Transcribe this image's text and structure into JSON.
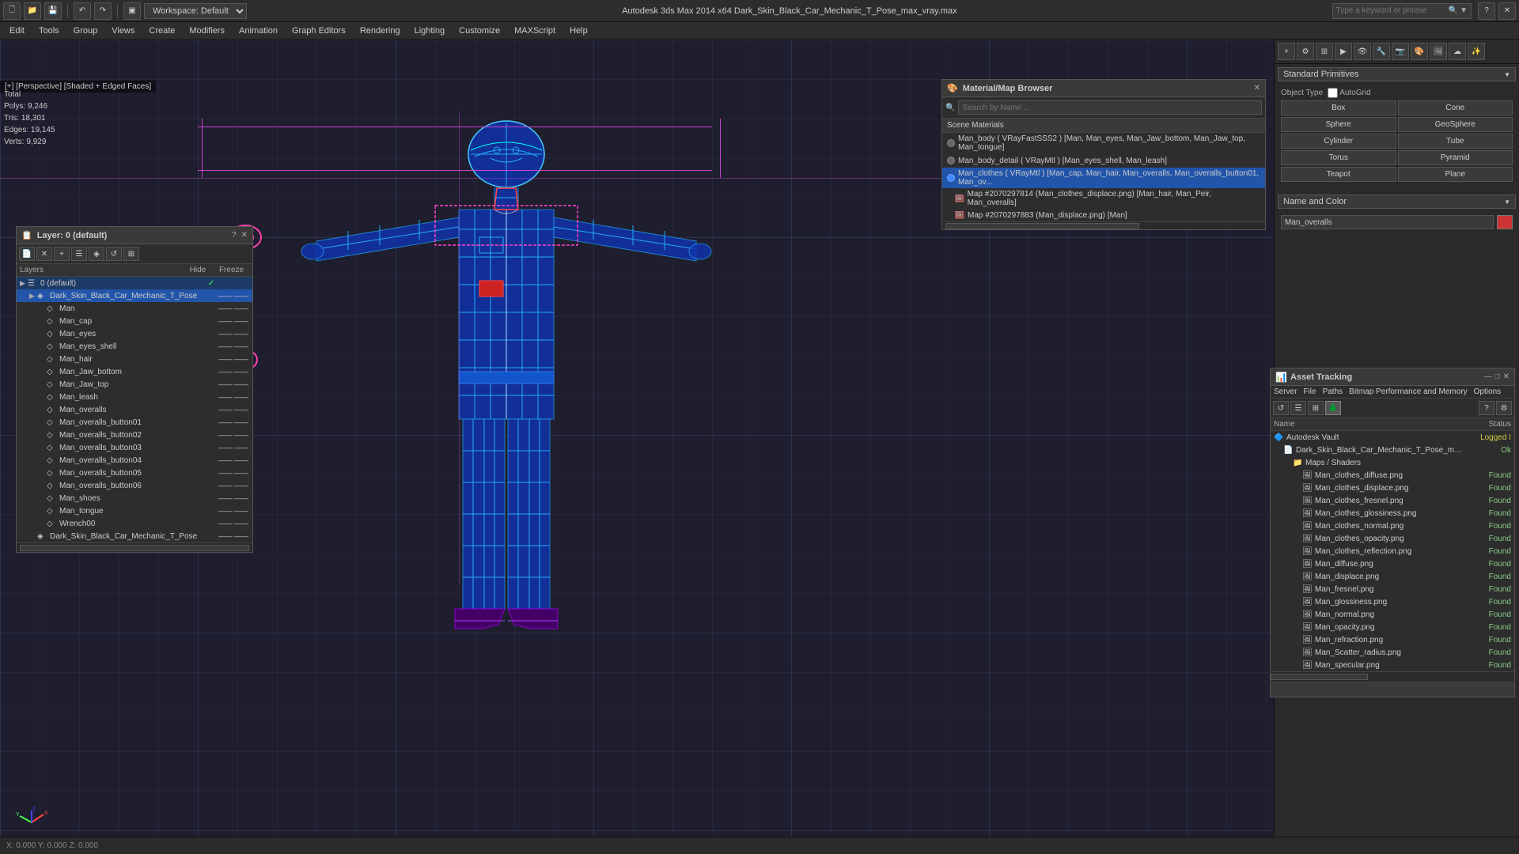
{
  "app": {
    "title": "Autodesk 3ds Max 2014 x64    Dark_Skin_Black_Car_Mechanic_T_Pose_max_vray.max",
    "workspace": "Workspace: Default"
  },
  "search": {
    "placeholder": "Type a keyword or phrase"
  },
  "menubar": {
    "items": [
      "Edit",
      "Tools",
      "Group",
      "Views",
      "Create",
      "Modifiers",
      "Animation",
      "Graph Editors",
      "Rendering",
      "Lighting",
      "Customize",
      "MAXScript",
      "Help"
    ]
  },
  "viewport": {
    "label": "[+] [Perspective] [Shaded + Edged Faces]"
  },
  "stats": {
    "polys_label": "Polys:",
    "polys_val": "9,246",
    "tris_label": "Tris:",
    "tris_val": "18,301",
    "edges_label": "Edges:",
    "edges_val": "19,145",
    "verts_label": "Verts:",
    "verts_val": "9,929",
    "total_label": "Total"
  },
  "layers_panel": {
    "title": "Layer: 0 (default)",
    "headers": {
      "name": "Layers",
      "hide": "Hide",
      "freeze": "Freeze"
    },
    "items": [
      {
        "indent": 0,
        "expand": true,
        "icon": "☰",
        "name": "0 (default)",
        "checked": true,
        "hide": "",
        "freeze": ""
      },
      {
        "indent": 1,
        "expand": true,
        "icon": "◈",
        "name": "Dark_Skin_Black_Car_Mechanic_T_Pose",
        "selected": true,
        "hide": "——",
        "freeze": "——"
      },
      {
        "indent": 2,
        "expand": false,
        "icon": "◇",
        "name": "Man",
        "hide": "——",
        "freeze": "——"
      },
      {
        "indent": 2,
        "expand": false,
        "icon": "◇",
        "name": "Man_cap",
        "hide": "——",
        "freeze": "——"
      },
      {
        "indent": 2,
        "expand": false,
        "icon": "◇",
        "name": "Man_eyes",
        "hide": "——",
        "freeze": "——"
      },
      {
        "indent": 2,
        "expand": false,
        "icon": "◇",
        "name": "Man_eyes_shell",
        "hide": "——",
        "freeze": "——"
      },
      {
        "indent": 2,
        "expand": false,
        "icon": "◇",
        "name": "Man_hair",
        "hide": "——",
        "freeze": "——"
      },
      {
        "indent": 2,
        "expand": false,
        "icon": "◇",
        "name": "Man_Jaw_bottom",
        "hide": "——",
        "freeze": "——"
      },
      {
        "indent": 2,
        "expand": false,
        "icon": "◇",
        "name": "Man_Jaw_top",
        "hide": "——",
        "freeze": "——"
      },
      {
        "indent": 2,
        "expand": false,
        "icon": "◇",
        "name": "Man_leash",
        "hide": "——",
        "freeze": "——"
      },
      {
        "indent": 2,
        "expand": false,
        "icon": "◇",
        "name": "Man_overalls",
        "hide": "——",
        "freeze": "——"
      },
      {
        "indent": 2,
        "expand": false,
        "icon": "◇",
        "name": "Man_overalls_button01",
        "hide": "——",
        "freeze": "——"
      },
      {
        "indent": 2,
        "expand": false,
        "icon": "◇",
        "name": "Man_overalls_button02",
        "hide": "——",
        "freeze": "——"
      },
      {
        "indent": 2,
        "expand": false,
        "icon": "◇",
        "name": "Man_overalls_button03",
        "hide": "——",
        "freeze": "——"
      },
      {
        "indent": 2,
        "expand": false,
        "icon": "◇",
        "name": "Man_overalls_button04",
        "hide": "——",
        "freeze": "——"
      },
      {
        "indent": 2,
        "expand": false,
        "icon": "◇",
        "name": "Man_overalls_button05",
        "hide": "——",
        "freeze": "——"
      },
      {
        "indent": 2,
        "expand": false,
        "icon": "◇",
        "name": "Man_overalls_button06",
        "hide": "——",
        "freeze": "——"
      },
      {
        "indent": 2,
        "expand": false,
        "icon": "◇",
        "name": "Man_shoes",
        "hide": "——",
        "freeze": "——"
      },
      {
        "indent": 2,
        "expand": false,
        "icon": "◇",
        "name": "Man_tongue",
        "hide": "——",
        "freeze": "——"
      },
      {
        "indent": 2,
        "expand": false,
        "icon": "◇",
        "name": "Wrench00",
        "hide": "——",
        "freeze": "——"
      },
      {
        "indent": 1,
        "expand": false,
        "icon": "◈",
        "name": "Dark_Skin_Black_Car_Mechanic_T_Pose",
        "hide": "——",
        "freeze": "——"
      }
    ]
  },
  "material_browser": {
    "title": "Material/Map Browser",
    "search_placeholder": "Search by Name ...",
    "scene_materials_header": "Scene Materials",
    "items": [
      {
        "type": "material",
        "selected": false,
        "text": "Man_body ( VRayFastSSS2 ) [Man, Man_eyes, Man_Jaw_bottom, Man_Jaw_top, Man_tongue]"
      },
      {
        "type": "material",
        "selected": false,
        "text": "Man_body_detail ( VRayMtl ) [Man_eyes_shell, Man_leash]"
      },
      {
        "type": "material",
        "selected": true,
        "text": "Man_clothes ( VRayMtl ) [Man_cap, Man_hair, Man_overalls, Man_overalls_button01, Man_ov..."
      }
    ],
    "maps": [
      {
        "text": "Map #2070297814 (Man_clothes_displace.png) [Man_hair, Man_Peir, Man_overalls]"
      },
      {
        "text": "Map #2070297883 (Man_displace.png) [Man]"
      }
    ]
  },
  "asset_tracking": {
    "title": "Asset Tracking",
    "menu_items": [
      "Server",
      "File",
      "Paths",
      "Bitmap Performance and Memory",
      "Options"
    ],
    "columns": {
      "name": "Name",
      "status": "Status"
    },
    "items": [
      {
        "indent": 0,
        "icon": "🔷",
        "name": "Autodesk Vault",
        "status": "Logged I",
        "status_type": "logged"
      },
      {
        "indent": 1,
        "icon": "📄",
        "name": "Dark_Skin_Black_Car_Mechanic_T_Pose_max_vray.max",
        "status": "Ok",
        "status_type": "ok"
      },
      {
        "indent": 2,
        "icon": "📁",
        "name": "Maps / Shaders",
        "status": "",
        "status_type": ""
      },
      {
        "indent": 3,
        "icon": "🖼",
        "name": "Man_clothes_diffuse.png",
        "status": "Found",
        "status_type": "ok"
      },
      {
        "indent": 3,
        "icon": "🖼",
        "name": "Man_clothes_displace.png",
        "status": "Found",
        "status_type": "ok"
      },
      {
        "indent": 3,
        "icon": "🖼",
        "name": "Man_clothes_fresnel.png",
        "status": "Found",
        "status_type": "ok"
      },
      {
        "indent": 3,
        "icon": "🖼",
        "name": "Man_clothes_glossiness.png",
        "status": "Found",
        "status_type": "ok"
      },
      {
        "indent": 3,
        "icon": "🖼",
        "name": "Man_clothes_normal.png",
        "status": "Found",
        "status_type": "ok"
      },
      {
        "indent": 3,
        "icon": "🖼",
        "name": "Man_clothes_opacity.png",
        "status": "Found",
        "status_type": "ok"
      },
      {
        "indent": 3,
        "icon": "🖼",
        "name": "Man_clothes_reflection.png",
        "status": "Found",
        "status_type": "ok"
      },
      {
        "indent": 3,
        "icon": "🖼",
        "name": "Man_diffuse.png",
        "status": "Found",
        "status_type": "ok"
      },
      {
        "indent": 3,
        "icon": "🖼",
        "name": "Man_displace.png",
        "status": "Found",
        "status_type": "ok"
      },
      {
        "indent": 3,
        "icon": "🖼",
        "name": "Man_fresnel.png",
        "status": "Found",
        "status_type": "ok"
      },
      {
        "indent": 3,
        "icon": "🖼",
        "name": "Man_glossiness.png",
        "status": "Found",
        "status_type": "ok"
      },
      {
        "indent": 3,
        "icon": "🖼",
        "name": "Man_normal.png",
        "status": "Found",
        "status_type": "ok"
      },
      {
        "indent": 3,
        "icon": "🖼",
        "name": "Man_opacity.png",
        "status": "Found",
        "status_type": "ok"
      },
      {
        "indent": 3,
        "icon": "🖼",
        "name": "Man_refraction.png",
        "status": "Found",
        "status_type": "ok"
      },
      {
        "indent": 3,
        "icon": "🖼",
        "name": "Man_Scatter_radius.png",
        "status": "Found",
        "status_type": "ok"
      },
      {
        "indent": 3,
        "icon": "🖼",
        "name": "Man_specular.png",
        "status": "Found",
        "status_type": "ok"
      }
    ]
  },
  "right_panel": {
    "std_primitives_label": "Standard Primitives",
    "object_type_label": "Object Type",
    "autogrid_label": "AutoGrid",
    "buttons": [
      "Box",
      "Cone",
      "Sphere",
      "GeoSphere",
      "Cylinder",
      "Tube",
      "Torus",
      "Pyramid",
      "Teapot",
      "Plane"
    ],
    "name_color_label": "Name and Color",
    "name_value": "Man_overalls"
  }
}
